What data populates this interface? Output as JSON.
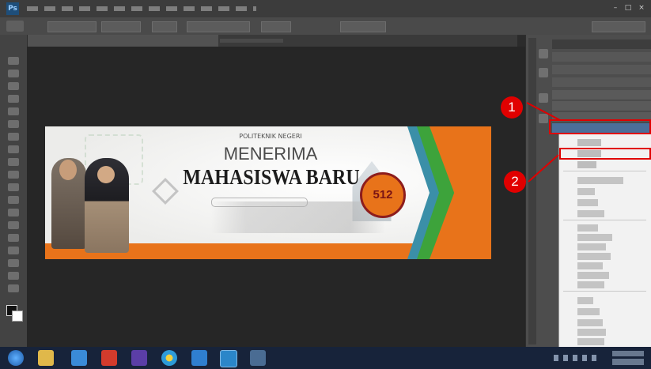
{
  "app": {
    "name": "Adobe Photoshop"
  },
  "colors": {
    "workspace": "#2b2b2b",
    "annotation_red": "#e00000",
    "banner_orange": "#e8731a",
    "banner_green": "#3da33b",
    "banner_teal": "#3b8fa8",
    "banner_title": "#1d1d1d",
    "taskbar": "#17233a"
  },
  "banner": {
    "top_text": "POLITEKNIK NEGERI",
    "line1": "MENERIMA",
    "line2": "MAHASISWA BARU",
    "logo_text": "512"
  },
  "annotations": {
    "marker1": "1",
    "marker2": "2"
  },
  "icons": {
    "ps_logo": "photoshop-icon",
    "windows": "windows-start-icon",
    "folder": "file-explorer-icon",
    "media": "media-player-icon",
    "browser": "chrome-icon"
  }
}
